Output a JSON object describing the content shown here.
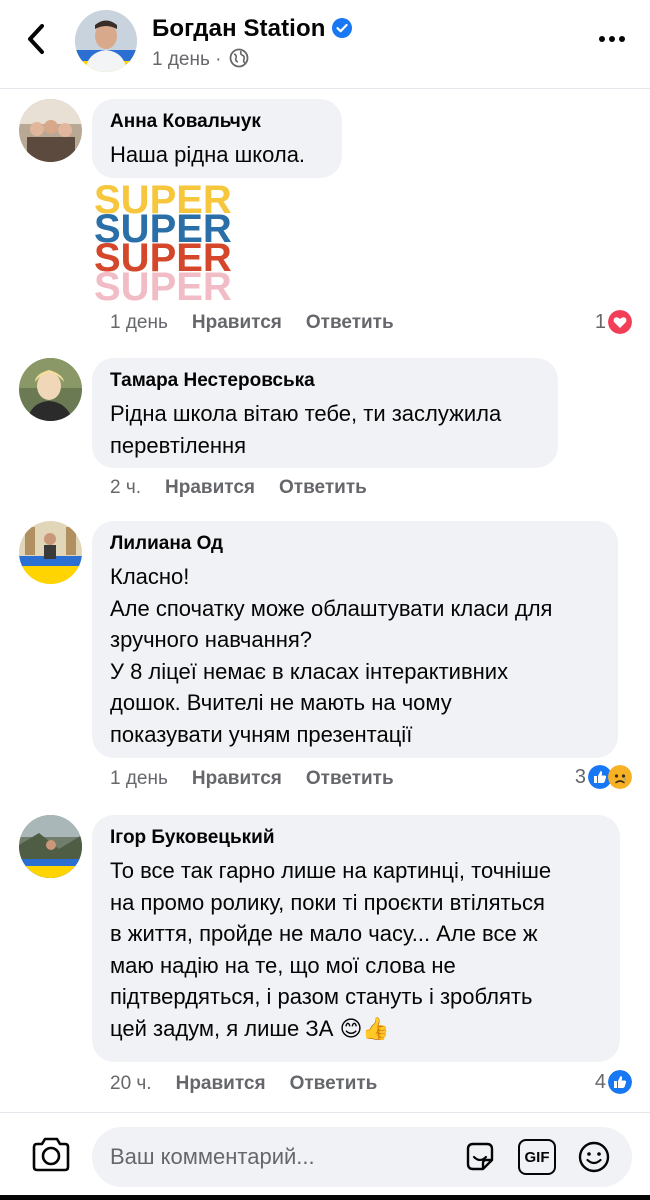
{
  "header": {
    "back_icon": "chevron-left-icon",
    "name": "Богдан Station",
    "time": "1 день",
    "privacy_icon": "globe-icon",
    "more_icon": "more-horizontal-icon",
    "verified_color": "#1877f2"
  },
  "comments": [
    {
      "author": "Анна Ковальчук",
      "text": "Наша рідна школа.",
      "sticker": [
        "SUPER",
        "SUPER",
        "SUPER",
        "SUPER"
      ],
      "time": "1 день",
      "like_label": "Нравится",
      "reply_label": "Ответить",
      "reaction_count": "1",
      "reactions": [
        "heart"
      ]
    },
    {
      "author": "Тамара Нестеровська",
      "text": "Рідна школа вітаю тебе, ти заслужила\nперевтілення",
      "time": "2 ч.",
      "like_label": "Нравится",
      "reply_label": "Ответить"
    },
    {
      "author": "Лилиана Од",
      "text": "Класно!\nАле спочатку може облаштувати класи для\nзручного навчання?\nУ 8 ліцеї немає в класах інтерактивних\nдошок. Вчителі не мають на чому\nпоказувати учням презентації",
      "time": "1 день",
      "like_label": "Нравится",
      "reply_label": "Ответить",
      "reaction_count": "3",
      "reactions": [
        "like",
        "sad"
      ]
    },
    {
      "author": "Ігор Буковецький",
      "text": "То все так гарно лише на картинці, точніше\nна промо ролику, поки ті проєкти втіляться\nв життя, пройде не мало часу... Але все ж\nмаю надію на те, що мої слова не\nпідтвердяться, і разом стануть і зроблять\nцей задум, я лише ЗА 😊👍",
      "time": "20 ч.",
      "like_label": "Нравится",
      "reply_label": "Ответить",
      "reaction_count": "4",
      "reactions": [
        "like"
      ]
    }
  ],
  "composer": {
    "placeholder": "Ваш комментарий...",
    "camera_icon": "camera-icon",
    "sticker_icon": "sticker-icon",
    "gif_label": "GIF",
    "emoji_icon": "emoji-icon"
  },
  "colors": {
    "accent": "#1877f2",
    "heart": "#f33e58",
    "bubble": "#f0f2f5",
    "secondary_text": "#65676b"
  }
}
